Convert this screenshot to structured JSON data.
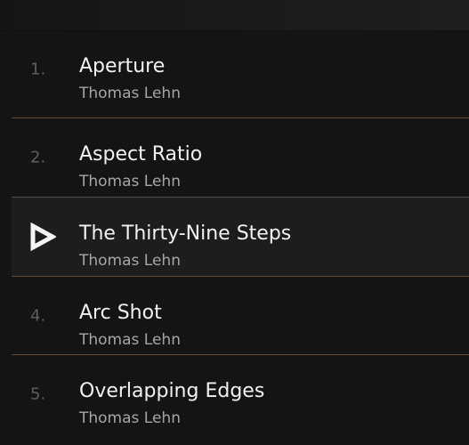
{
  "tracks": [
    {
      "number": "1.",
      "title": "Aperture",
      "artist": "Thomas Lehn",
      "playing": false
    },
    {
      "number": "2.",
      "title": "Aspect Ratio",
      "artist": "Thomas Lehn",
      "playing": false
    },
    {
      "number": "",
      "title": "The Thirty-Nine Steps",
      "artist": "Thomas Lehn",
      "playing": true,
      "indicator_icon": "play-icon"
    },
    {
      "number": "4.",
      "title": "Arc Shot",
      "artist": "Thomas Lehn",
      "playing": false
    },
    {
      "number": "5.",
      "title": "Overlapping Edges",
      "artist": "Thomas Lehn",
      "playing": false
    }
  ],
  "colors": {
    "background": "#141414",
    "playing_row": "#1d1d1d",
    "divider": "#5a4e40",
    "title_text": "#f2f2f2",
    "artist_text": "#a6a6a6",
    "number_text": "#5e5e5e"
  }
}
